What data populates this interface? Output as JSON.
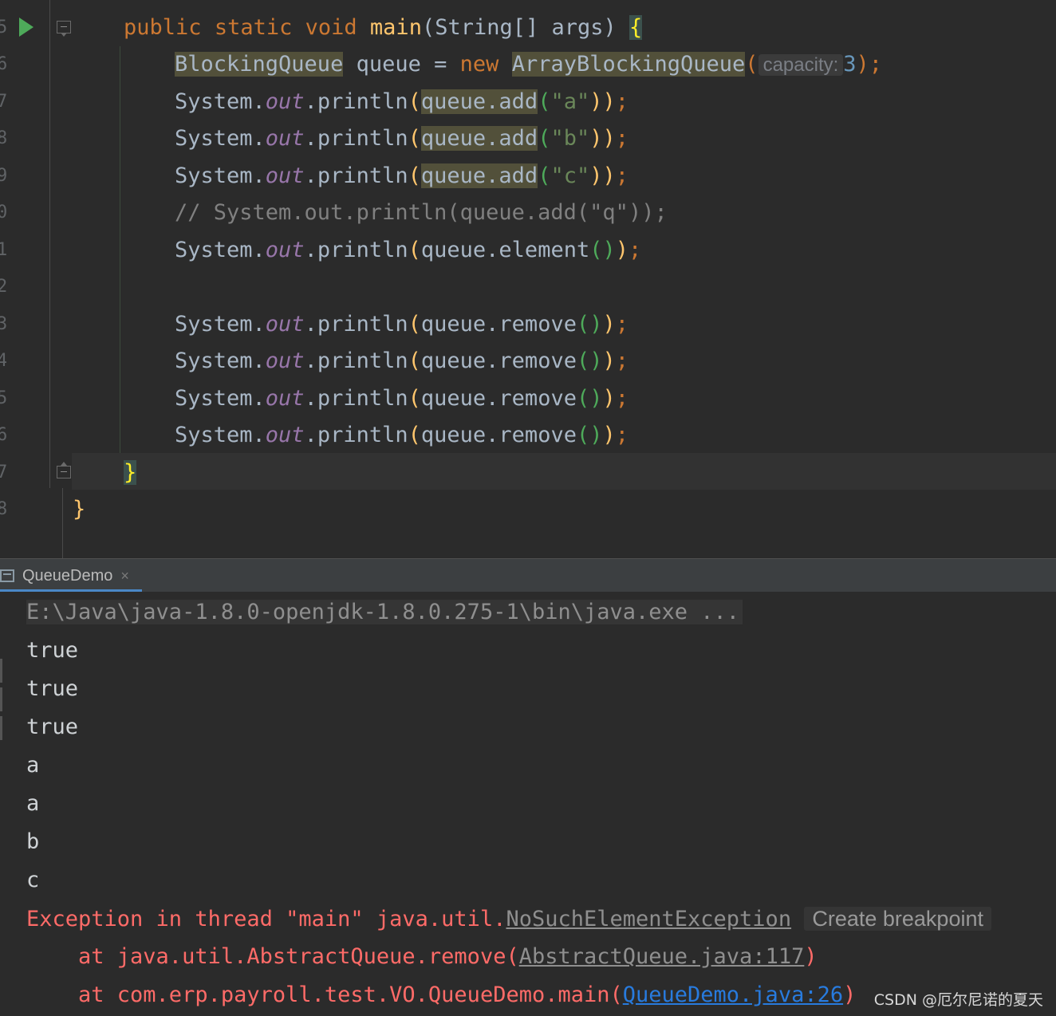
{
  "editor": {
    "gutter_numbers": [
      "5",
      "6",
      "7",
      "8",
      "9",
      "0",
      "1",
      "2",
      "3",
      "4",
      "5",
      "6",
      "7",
      "8"
    ],
    "code": {
      "l1": {
        "kw1": "public",
        "kw2": "static",
        "kw3": "void",
        "fn": "main",
        "p1": "(String[] args) ",
        "brace": "{"
      },
      "l2": {
        "type1": "BlockingQueue",
        "mid": " queue = ",
        "kw": "new",
        "sp": " ",
        "type2": "ArrayBlockingQueue",
        "paren": "(",
        "hint": "capacity:",
        "num": "3",
        "end": ");"
      },
      "l3": {
        "a": "System.",
        "b": "out",
        "c": ".println",
        "d": "(",
        "e": "queue.add",
        "f": "(",
        "g": "\"a\"",
        "h": "))",
        "i": ";"
      },
      "l4": {
        "a": "System.",
        "b": "out",
        "c": ".println",
        "d": "(",
        "e": "queue.add",
        "f": "(",
        "g": "\"b\"",
        "h": "))",
        "i": ";"
      },
      "l5": {
        "a": "System.",
        "b": "out",
        "c": ".println",
        "d": "(",
        "e": "queue.add",
        "f": "(",
        "g": "\"c\"",
        "h": "))",
        "i": ";"
      },
      "l6": {
        "comment": "// System.out.println(queue.add(\"q\"));"
      },
      "l7": {
        "a": "System.",
        "b": "out",
        "c": ".println",
        "d": "(",
        "e": "queue.element",
        "f": "()",
        "h": ")",
        "i": ";"
      },
      "l9": {
        "a": "System.",
        "b": "out",
        "c": ".println",
        "d": "(",
        "e": "queue.remove",
        "f": "()",
        "h": ")",
        "i": ";"
      },
      "l10": {
        "a": "System.",
        "b": "out",
        "c": ".println",
        "d": "(",
        "e": "queue.remove",
        "f": "()",
        "h": ")",
        "i": ";"
      },
      "l11": {
        "a": "System.",
        "b": "out",
        "c": ".println",
        "d": "(",
        "e": "queue.remove",
        "f": "()",
        "h": ")",
        "i": ";"
      },
      "l12": {
        "a": "System.",
        "b": "out",
        "c": ".println",
        "d": "(",
        "e": "queue.remove",
        "f": "()",
        "h": ")",
        "i": ";"
      },
      "l13": {
        "brace": "}"
      },
      "l14": {
        "brace": "}"
      }
    }
  },
  "run_panel": {
    "tab_label": "QueueDemo",
    "tab_close": "×",
    "command": "E:\\Java\\java-1.8.0-openjdk-1.8.0.275-1\\bin\\java.exe ...",
    "output": [
      "true",
      "true",
      "true",
      "a",
      "a",
      "b",
      "c"
    ],
    "exception": {
      "prefix": "Exception in thread \"main\" java.util.",
      "class_link": "NoSuchElementException",
      "breakpoint_hint": "Create breakpoint",
      "frame1_prefix": "    at java.util.AbstractQueue.remove(",
      "frame1_link": "AbstractQueue.java:117",
      "frame1_suffix": ")",
      "frame2_prefix": "    at com.erp.payroll.test.VO.QueueDemo.main(",
      "frame2_link": "QueueDemo.java:26",
      "frame2_suffix": ")"
    }
  },
  "watermark": "CSDN @厄尔尼诺的夏天"
}
